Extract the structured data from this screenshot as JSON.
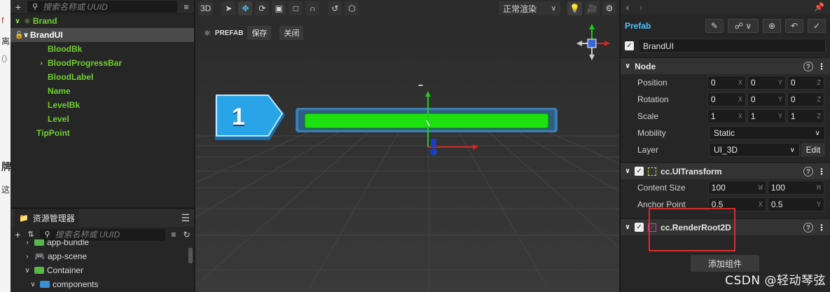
{
  "background_doc": {
    "fragments": [
      "f",
      "离",
      "()",
      "牌",
      "这"
    ]
  },
  "hierarchy": {
    "search_placeholder": "搜索名称或 UUID",
    "nodes": [
      {
        "label": "Brand",
        "arrow": "v",
        "selected": false
      },
      {
        "label": "BrandUI",
        "arrow": "v",
        "selected": true
      },
      {
        "label": "BloodBk",
        "arrow": "",
        "selected": false
      },
      {
        "label": "BloodProgressBar",
        "arrow": ">",
        "selected": false
      },
      {
        "label": "BloodLabel",
        "arrow": "",
        "selected": false
      },
      {
        "label": "Name",
        "arrow": "",
        "selected": false
      },
      {
        "label": "LevelBk",
        "arrow": "",
        "selected": false
      },
      {
        "label": "Level",
        "arrow": "",
        "selected": false
      },
      {
        "label": "TipPoint",
        "arrow": "",
        "selected": false
      }
    ]
  },
  "assets": {
    "title": "资源管理器",
    "search_placeholder": "搜索名称或 UUID",
    "items": [
      {
        "label": "app-bundle",
        "arrow": ">"
      },
      {
        "label": "app-scene",
        "arrow": ">"
      },
      {
        "label": "Container",
        "arrow": "v"
      },
      {
        "label": "components",
        "arrow": "v"
      }
    ]
  },
  "scene": {
    "mode_label": "3D",
    "render_mode": "正常渲染",
    "prefab_tag": "PREFAB",
    "save_label": "保存",
    "close_label": "关闭",
    "level_number": "1",
    "bar_color": "#1ee010",
    "gizmo_label": "--"
  },
  "inspector": {
    "prefab_label": "Prefab",
    "node_name": "BrandUI",
    "node_section": "Node",
    "position": {
      "label": "Position",
      "x": "0",
      "y": "0",
      "z": "0"
    },
    "rotation": {
      "label": "Rotation",
      "x": "0",
      "y": "0",
      "z": "0"
    },
    "scale": {
      "label": "Scale",
      "x": "1",
      "y": "1",
      "z": "1"
    },
    "mobility": {
      "label": "Mobility",
      "value": "Static"
    },
    "layer": {
      "label": "Layer",
      "value": "UI_3D",
      "edit_label": "Edit"
    },
    "ui_transform": {
      "title": "cc.UITransform",
      "content_size": {
        "label": "Content Size",
        "w": "100",
        "h": "100"
      },
      "anchor_point": {
        "label": "Anchor Point",
        "x": "0.5",
        "y": "0.5"
      }
    },
    "render_root": {
      "title": "cc.RenderRoot2D"
    },
    "add_component_label": "添加组件"
  },
  "watermark": "CSDN @轻动琴弦"
}
